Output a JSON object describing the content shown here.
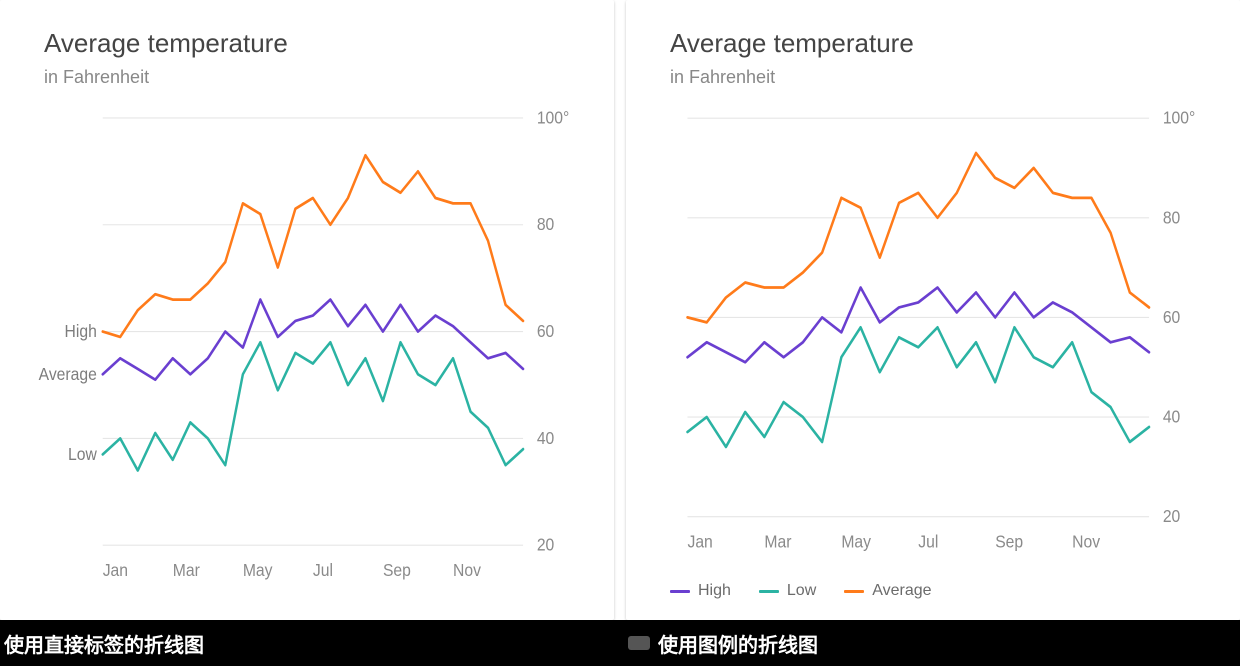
{
  "chart_data": [
    {
      "type": "line",
      "title": "Average temperature",
      "subtitle": "in Fahrenheit",
      "ylabel": "",
      "ylim": [
        20,
        100
      ],
      "y_ticks": [
        20,
        40,
        60,
        80,
        100
      ],
      "y_tick_labels": [
        "20",
        "40",
        "60",
        "80",
        "100°"
      ],
      "x_tick_labels": [
        "Jan",
        "Mar",
        "May",
        "Jul",
        "Sep",
        "Nov"
      ],
      "label_style": "inline",
      "inline_labels": [
        "High",
        "Average",
        "Low"
      ],
      "colors": {
        "High": "#ff7b1a",
        "Average": "#6a3fd0",
        "Low": "#2bb3a3"
      },
      "x": [
        1,
        2,
        3,
        4,
        5,
        6,
        7,
        8,
        9,
        10,
        11,
        12,
        13,
        14,
        15,
        16,
        17,
        18,
        19,
        20,
        21,
        22,
        23,
        24,
        25
      ],
      "series": [
        {
          "name": "High",
          "values": [
            60,
            59,
            64,
            67,
            66,
            66,
            69,
            73,
            84,
            82,
            72,
            83,
            85,
            80,
            85,
            93,
            88,
            86,
            90,
            85,
            84,
            84,
            77,
            65,
            62
          ]
        },
        {
          "name": "Average",
          "values": [
            52,
            55,
            53,
            51,
            55,
            52,
            55,
            60,
            57,
            66,
            59,
            62,
            63,
            66,
            61,
            65,
            60,
            65,
            60,
            63,
            61,
            58,
            55,
            56,
            53
          ]
        },
        {
          "name": "Low",
          "values": [
            37,
            40,
            34,
            41,
            36,
            43,
            40,
            35,
            52,
            58,
            49,
            56,
            54,
            58,
            50,
            55,
            47,
            58,
            52,
            50,
            55,
            45,
            42,
            35,
            38
          ]
        }
      ]
    },
    {
      "type": "line",
      "title": "Average temperature",
      "subtitle": "in Fahrenheit",
      "ylabel": "",
      "ylim": [
        20,
        100
      ],
      "y_ticks": [
        20,
        40,
        60,
        80,
        100
      ],
      "y_tick_labels": [
        "20",
        "40",
        "60",
        "80",
        "100°"
      ],
      "x_tick_labels": [
        "Jan",
        "Mar",
        "May",
        "Jul",
        "Sep",
        "Nov"
      ],
      "label_style": "legend",
      "legend_order": [
        "High",
        "Low",
        "Average"
      ],
      "colors": {
        "High": "#6a3fd0",
        "Low": "#2bb3a3",
        "Average": "#ff7b1a"
      },
      "x": [
        1,
        2,
        3,
        4,
        5,
        6,
        7,
        8,
        9,
        10,
        11,
        12,
        13,
        14,
        15,
        16,
        17,
        18,
        19,
        20,
        21,
        22,
        23,
        24,
        25
      ],
      "series": [
        {
          "name": "High",
          "values": [
            52,
            55,
            53,
            51,
            55,
            52,
            55,
            60,
            57,
            66,
            59,
            62,
            63,
            66,
            61,
            65,
            60,
            65,
            60,
            63,
            61,
            58,
            55,
            56,
            53
          ]
        },
        {
          "name": "Low",
          "values": [
            37,
            40,
            34,
            41,
            36,
            43,
            40,
            35,
            52,
            58,
            49,
            56,
            54,
            58,
            50,
            55,
            47,
            58,
            52,
            50,
            55,
            45,
            42,
            35,
            38
          ]
        },
        {
          "name": "Average",
          "values": [
            60,
            59,
            64,
            67,
            66,
            66,
            69,
            73,
            84,
            82,
            72,
            83,
            85,
            80,
            85,
            93,
            88,
            86,
            90,
            85,
            84,
            84,
            77,
            65,
            62
          ]
        }
      ]
    }
  ],
  "captions": {
    "left": "使用直接标签的折线图",
    "right": "使用图例的折线图"
  }
}
